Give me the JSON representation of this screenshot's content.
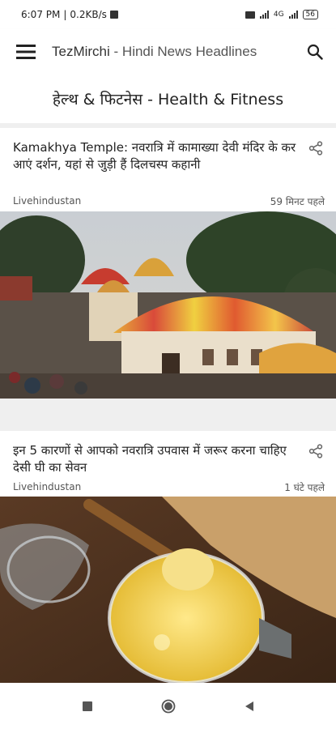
{
  "status_bar": {
    "time": "6:07 PM",
    "network_speed": "0.2KB/s",
    "battery_level": "56",
    "network_label": "4G"
  },
  "app_bar": {
    "title": "TezMirchi",
    "subtitle": "- Hindi News Headlines",
    "menu_icon": "hamburger-menu-icon",
    "search_icon": "search-icon"
  },
  "section": {
    "title": "हेल्थ & फिटनेस - Health & Fitness"
  },
  "articles": [
    {
      "title": "Kamakhya Temple: नवरात्रि में कामाख्या देवी मंदिर के कर आएं दर्शन, यहां से जुड़ी हैं दिलचस्प कहानी",
      "source": "Livehindustan",
      "time": "59 मिनट पहले",
      "share_icon": "share-icon",
      "image": "temple-photo"
    },
    {
      "title": "इन 5 कारणों से आपको नवरात्रि उपवास में जरूर करना चाहिए देसी घी का सेवन",
      "source": "Livehindustan",
      "time": "1 घंटे पहले",
      "share_icon": "share-icon",
      "image": "ghee-jar-photo"
    }
  ],
  "nav_bar": {
    "recents_icon": "square-recents-icon",
    "home_icon": "circle-home-icon",
    "back_icon": "triangle-back-icon"
  },
  "colors": {
    "background": "#efefef",
    "card": "#ffffff",
    "text": "#222222"
  }
}
